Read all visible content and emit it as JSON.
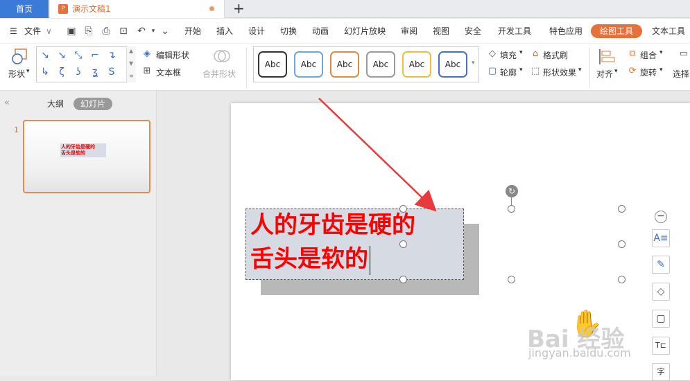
{
  "tabs": {
    "home_label": "首页",
    "doc_label": "演示文稿1",
    "new_tab_glyph": "+"
  },
  "menu": {
    "file_label": "文件",
    "items": [
      "开始",
      "插入",
      "设计",
      "切换",
      "动画",
      "幻灯片放映",
      "审阅",
      "视图",
      "安全",
      "开发工具",
      "特色应用",
      "绘图工具",
      "文本工具"
    ],
    "active_item": "绘图工具"
  },
  "ribbon": {
    "shape_label": "形状",
    "edit_shape_label": "编辑形状",
    "textbox_label": "文本框",
    "merge_shape_label": "合并形状",
    "style_samples": [
      "Abc",
      "Abc",
      "Abc",
      "Abc",
      "Abc",
      "Abc"
    ],
    "style_colors": [
      "#222222",
      "#6fa4d8",
      "#e08a4a",
      "#9a9a9a",
      "#e8c040",
      "#4a6fbf"
    ],
    "fill_label": "填充",
    "format_brush_label": "格式刷",
    "outline_label": "轮廓",
    "shape_effect_label": "形状效果",
    "align_label": "对齐",
    "group_label": "组合",
    "rotate_label": "旋转",
    "select_label": "选择"
  },
  "panel": {
    "tab_outline": "大纲",
    "tab_slides": "幻灯片",
    "slide_number": "1",
    "thumb_line1": "人的牙齿是硬的",
    "thumb_line2": "舌头是软的"
  },
  "slide": {
    "line1": "人的牙齿是硬的",
    "line2": "舌头是软的"
  },
  "float_tools": [
    "text-select-icon",
    "brush-icon",
    "eraser-icon",
    "border-icon",
    "text-wrap-icon",
    "char-icon"
  ],
  "watermark": {
    "brand": "Bai  经验",
    "url": "jingyan.baidu.com"
  },
  "colors": {
    "accent": "#e8703a",
    "home_tab": "#3c7ad8",
    "text_red": "#ff0000",
    "arrow": "#e83a3a"
  }
}
